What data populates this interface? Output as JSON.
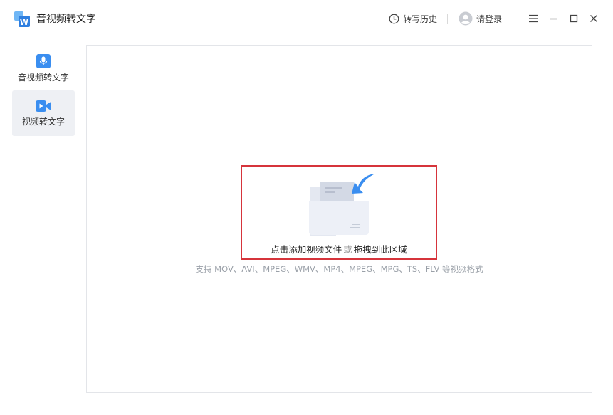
{
  "app": {
    "title": "音视频转文字",
    "logo_text": "W"
  },
  "header": {
    "history_label": "转写历史",
    "login_label": "请登录"
  },
  "sidebar": {
    "items": [
      {
        "label": "音视频转文字",
        "icon": "microphone-icon",
        "active": false
      },
      {
        "label": "视频转文字",
        "icon": "video-camera-icon",
        "active": true
      }
    ]
  },
  "main": {
    "drop_primary": "点击添加视频文件",
    "drop_or": "或",
    "drop_secondary": "拖拽到此区域",
    "formats_hint": "支持 MOV、AVI、MPEG、WMV、MP4、MPEG、MPG、TS、FLV 等视频格式"
  },
  "colors": {
    "accent": "#3a8ef0",
    "highlight_border": "#d6343b",
    "hint_text": "#9aa0a8"
  }
}
